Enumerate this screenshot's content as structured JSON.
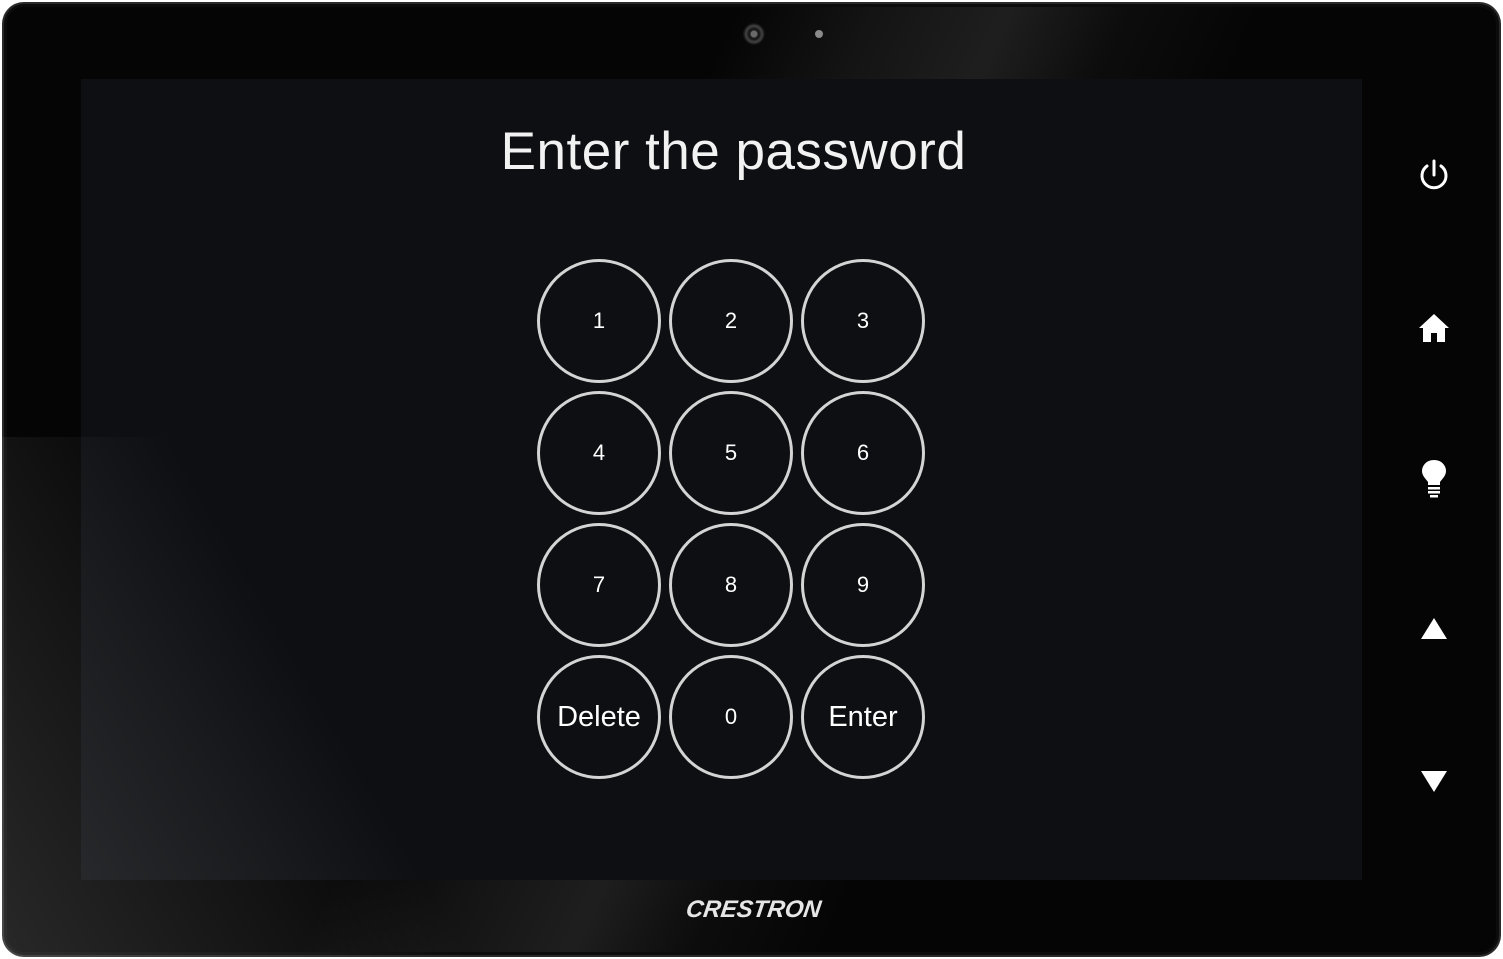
{
  "screen": {
    "title": "Enter the password"
  },
  "keypad": {
    "keys": [
      {
        "label": "1"
      },
      {
        "label": "2"
      },
      {
        "label": "3"
      },
      {
        "label": "4"
      },
      {
        "label": "5"
      },
      {
        "label": "6"
      },
      {
        "label": "7"
      },
      {
        "label": "8"
      },
      {
        "label": "9"
      },
      {
        "label": "Delete"
      },
      {
        "label": "0"
      },
      {
        "label": "Enter"
      }
    ]
  },
  "hardware_buttons": [
    {
      "icon": "power-icon"
    },
    {
      "icon": "home-icon"
    },
    {
      "icon": "lightbulb-icon"
    },
    {
      "icon": "arrow-up-icon"
    },
    {
      "icon": "arrow-down-icon"
    }
  ],
  "brand": {
    "logo_text": "CRESTRON"
  },
  "colors": {
    "bezel": "#050505",
    "screen_background": "#0d0f12",
    "key_border": "#d4d4d4",
    "text": "#ffffff"
  }
}
